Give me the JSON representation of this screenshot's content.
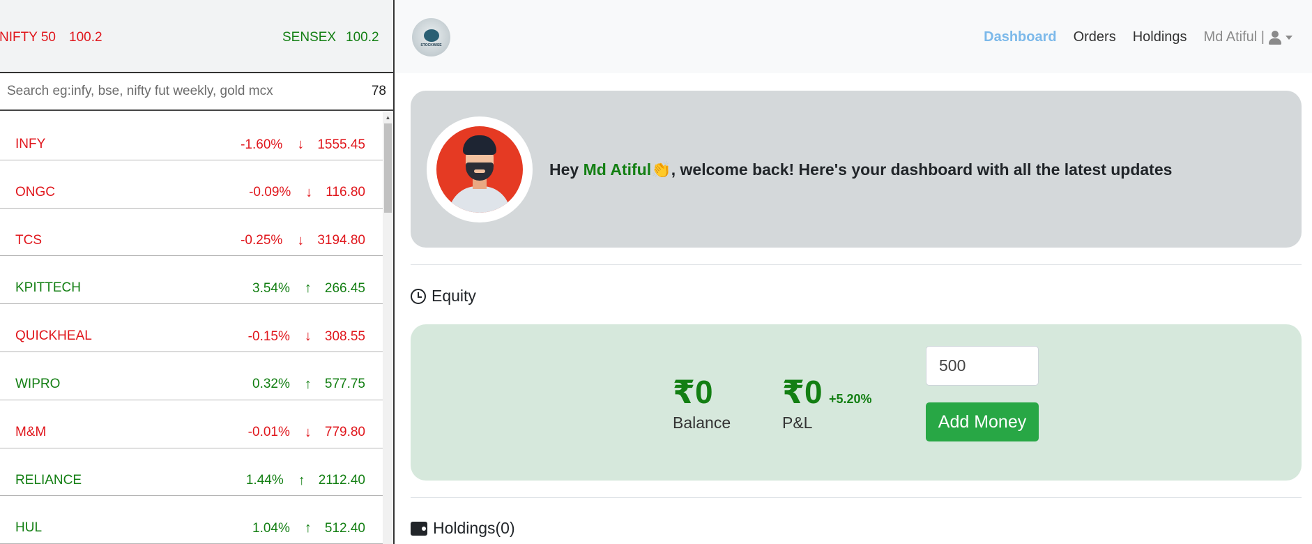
{
  "indices": [
    {
      "name": "NIFTY 50",
      "value": "100.2",
      "color": "#e0171d"
    },
    {
      "name": "SENSEX",
      "value": "100.2",
      "color": "#137f13"
    }
  ],
  "search": {
    "placeholder": "Search eg:infy, bse, nifty fut weekly, gold mcx",
    "count": "78"
  },
  "watchlist": [
    {
      "name": "INFY",
      "percent": "-1.60%",
      "direction": "down",
      "price": "1555.45"
    },
    {
      "name": "ONGC",
      "percent": "-0.09%",
      "direction": "down",
      "price": "116.80"
    },
    {
      "name": "TCS",
      "percent": "-0.25%",
      "direction": "down",
      "price": "3194.80"
    },
    {
      "name": "KPITTECH",
      "percent": "3.54%",
      "direction": "up",
      "price": "266.45"
    },
    {
      "name": "QUICKHEAL",
      "percent": "-0.15%",
      "direction": "down",
      "price": "308.55"
    },
    {
      "name": "WIPRO",
      "percent": "0.32%",
      "direction": "up",
      "price": "577.75"
    },
    {
      "name": "M&M",
      "percent": "-0.01%",
      "direction": "down",
      "price": "779.80"
    },
    {
      "name": "RELIANCE",
      "percent": "1.44%",
      "direction": "up",
      "price": "2112.40"
    },
    {
      "name": "HUL",
      "percent": "1.04%",
      "direction": "up",
      "price": "512.40"
    }
  ],
  "colors": {
    "up": "#137f13",
    "down": "#e0171d",
    "nav_active": "#7cb9ea",
    "add_button": "#28a745"
  },
  "nav": {
    "logo_text": "STOCKWISE",
    "links": [
      "Dashboard",
      "Orders",
      "Holdings"
    ],
    "active": "Dashboard",
    "user": "Md Atiful |"
  },
  "welcome": {
    "greeting": "Hey ",
    "name": "Md Atiful",
    "emoji": "👏",
    "message": ", welcome back! Here's your dashboard with all the latest updates"
  },
  "equity": {
    "title": "Equity",
    "balance_value": "₹0",
    "balance_label": "Balance",
    "pnl_value": "₹0",
    "pnl_percent": "+5.20%",
    "pnl_label": "P&L",
    "amount": "500",
    "add_button": "Add Money"
  },
  "holdings": {
    "title": "Holdings(0)"
  }
}
